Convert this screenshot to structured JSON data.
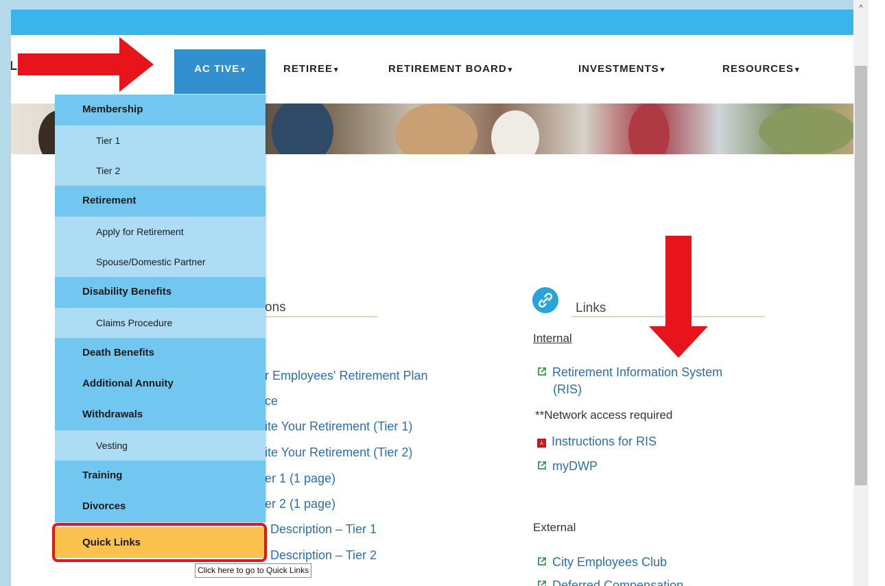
{
  "nav": {
    "logo_partial": "LAN",
    "active": "AC TIVE",
    "retiree": "RETIREE",
    "board": "RETIREMENT BOARD",
    "investments": "INVESTMENTS",
    "resources": "RESOURCES",
    "caret": "▾"
  },
  "menu": {
    "items": [
      {
        "label": "Membership",
        "type": "header"
      },
      {
        "label": "Tier 1",
        "type": "sub"
      },
      {
        "label": "Tier 2",
        "type": "sub"
      },
      {
        "label": "Retirement",
        "type": "header"
      },
      {
        "label": "Apply for Retirement",
        "type": "sub"
      },
      {
        "label": "Spouse/Domestic Partner",
        "type": "sub"
      },
      {
        "label": "Disability Benefits",
        "type": "header"
      },
      {
        "label": "Claims Procedure",
        "type": "sub"
      },
      {
        "label": "Death Benefits",
        "type": "header"
      },
      {
        "label": "Additional Annuity",
        "type": "header"
      },
      {
        "label": "Withdrawals",
        "type": "header"
      },
      {
        "label": "Vesting",
        "type": "sub"
      },
      {
        "label": "Training",
        "type": "header"
      },
      {
        "label": "Divorces",
        "type": "header"
      }
    ],
    "quick_links": "Quick Links",
    "tooltip": "Click here to go to Quick Links"
  },
  "publications": {
    "title_partial": "ons",
    "items": [
      "r Employees' Retirement Plan",
      "ce",
      "ite Your Retirement (Tier 1)",
      "ite Your Retirement (Tier 2)",
      "er 1 (1 page)",
      "er 2 (1 page)",
      "Description – Tier 1",
      "Description – Tier 2"
    ]
  },
  "links": {
    "title": "Links",
    "internal_label": "Internal",
    "ris_line1": "Retirement Information System",
    "ris_line2": "(RIS)",
    "network_note": "**Network access required",
    "instructions": "Instructions for RIS",
    "mydwp": "myDWP",
    "external_label": "External",
    "city_club": "City Employees Club",
    "deferred_partial": "Deferred Compensation"
  },
  "colors": {
    "top_strip": "#3bb4ec",
    "nav_active": "#3390cf",
    "menu_header": "#71c7ef",
    "menu_sub": "#acddf5",
    "quick_links": "#fcc24e",
    "highlight": "#e8141b",
    "link": "#2a6fad"
  },
  "icons": {
    "external_link": "external-link-icon",
    "pdf": "pdf-icon",
    "links_section": "chain-link-icon",
    "scroll_up": "scroll-up-arrow-icon"
  }
}
